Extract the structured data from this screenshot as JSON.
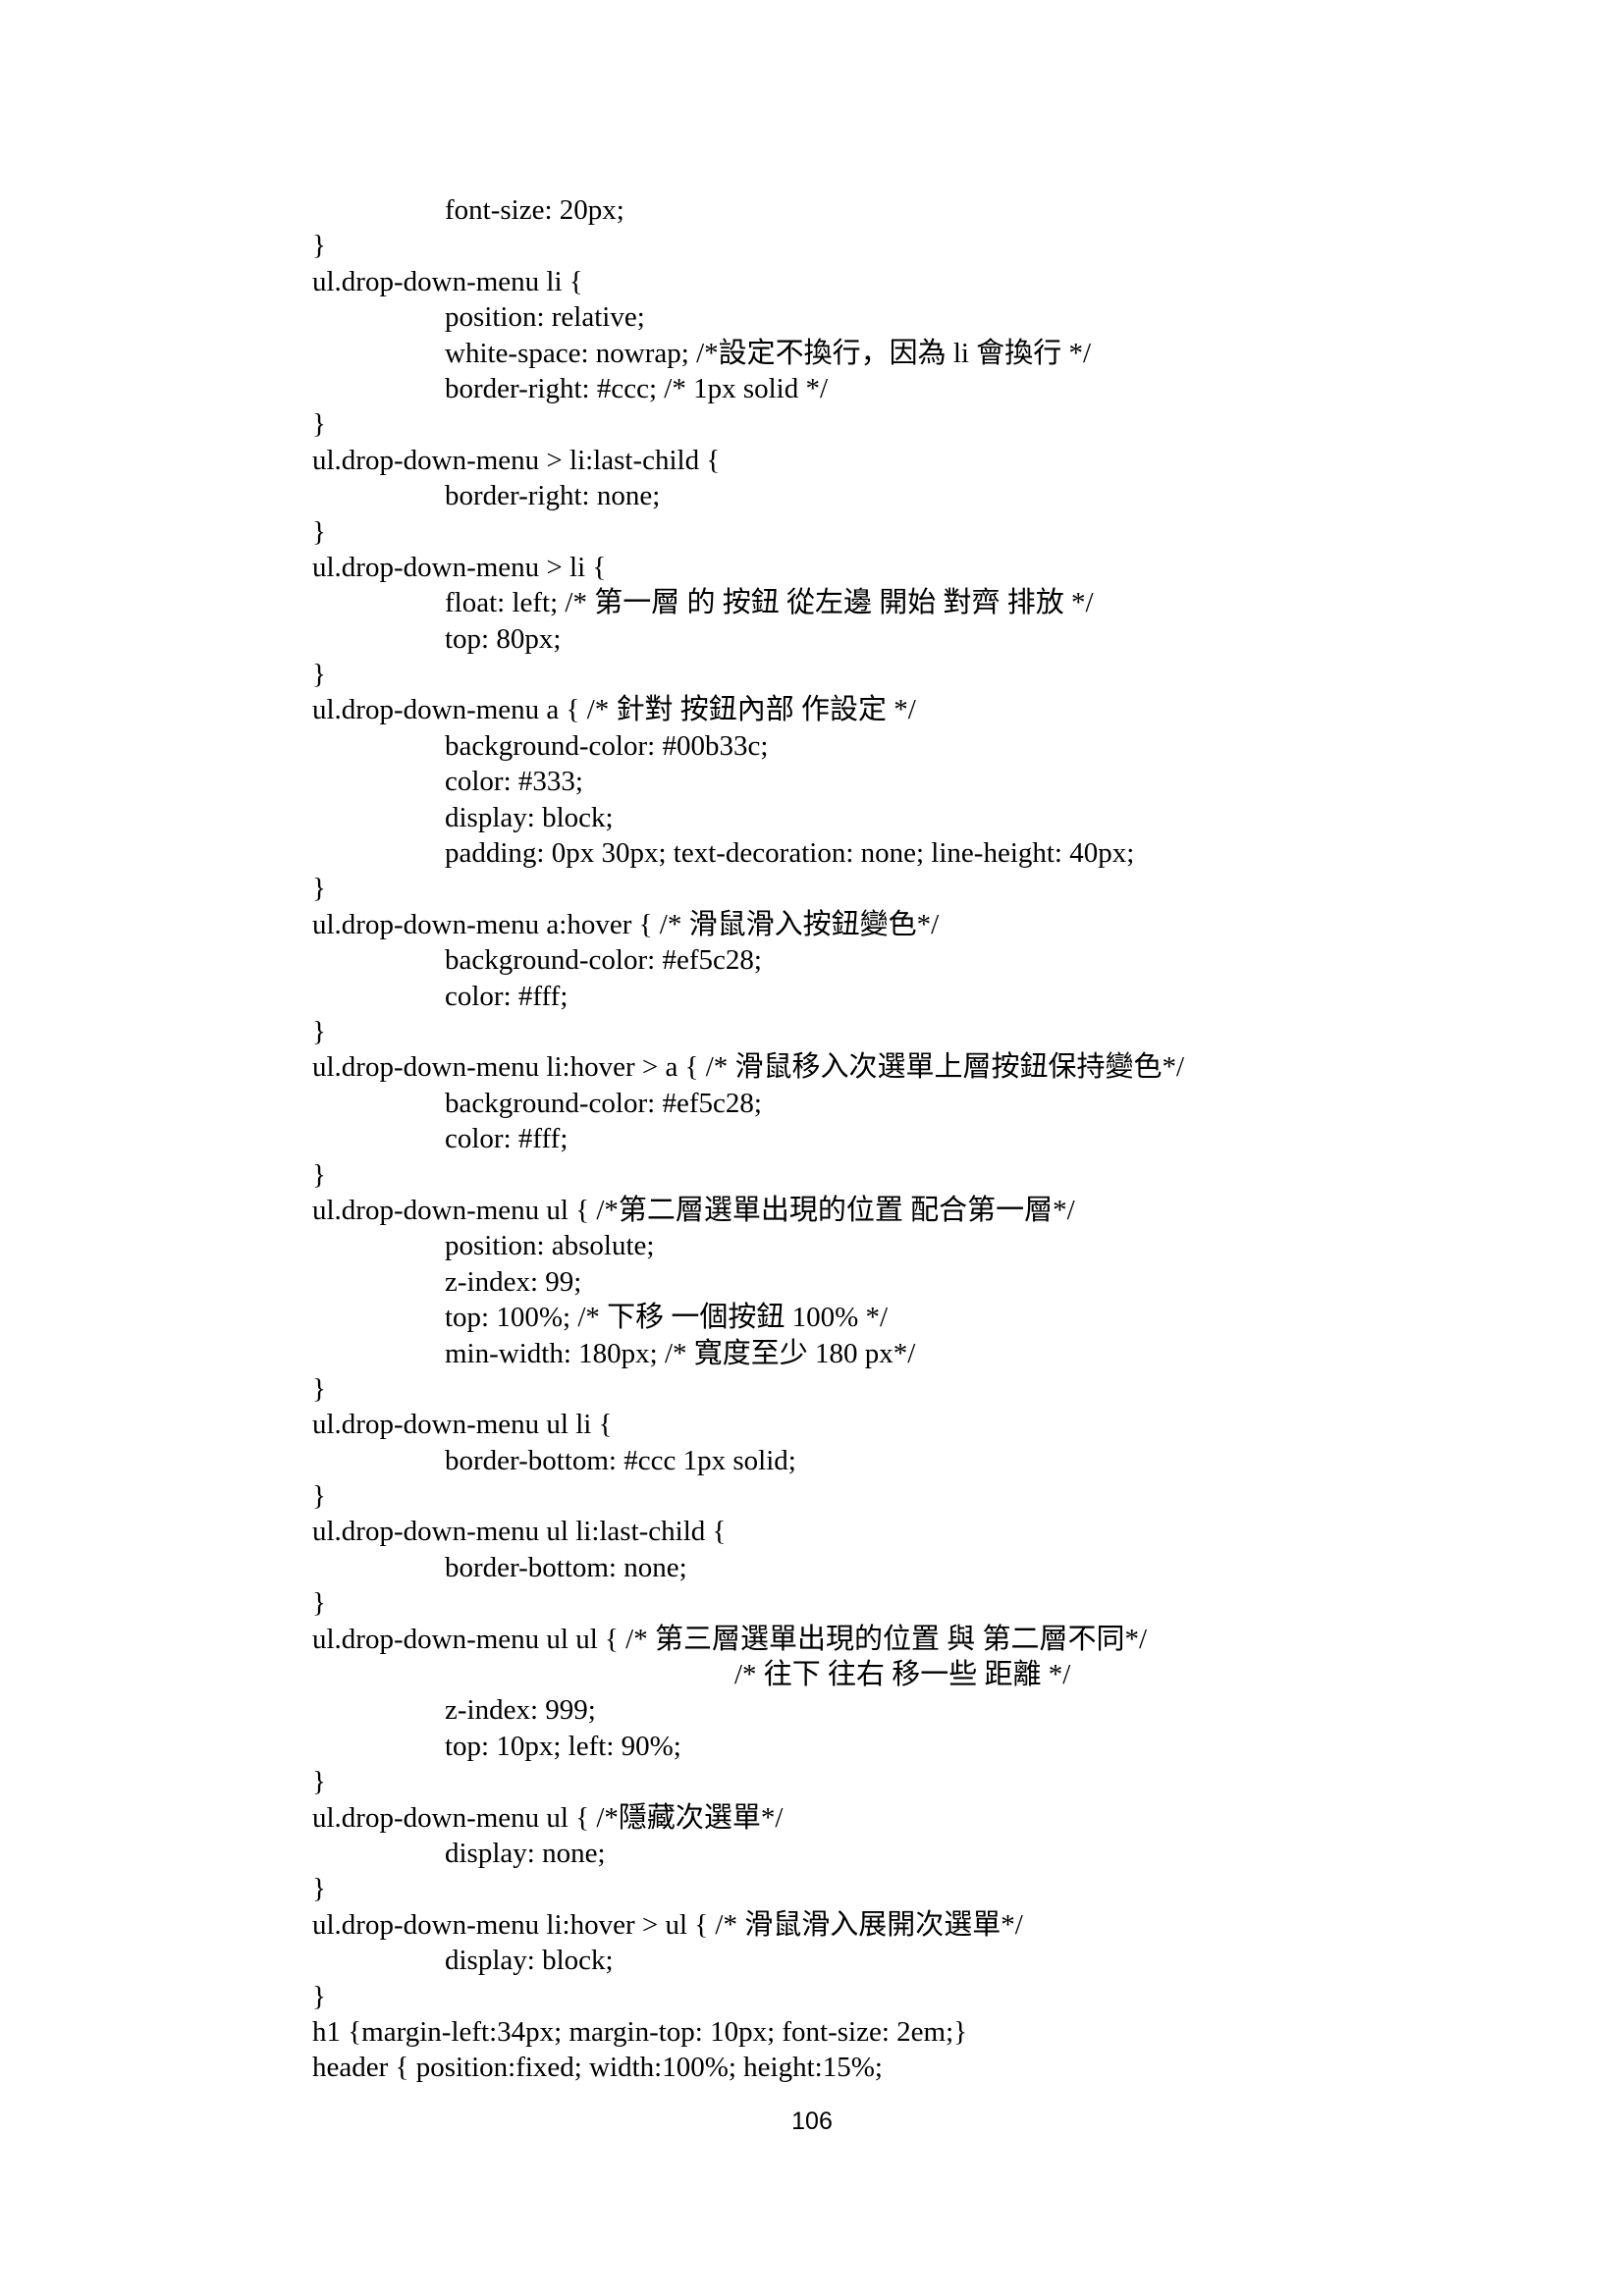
{
  "document": {
    "lines": [
      {
        "indent": 1,
        "text": "font-size: 20px;"
      },
      {
        "indent": 0,
        "text": "}"
      },
      {
        "indent": 0,
        "text": "ul.drop-down-menu li {"
      },
      {
        "indent": 1,
        "text": "position: relative;"
      },
      {
        "indent": 1,
        "text": "white-space: nowrap; /*設定不換行，因為 li 會換行 */"
      },
      {
        "indent": 1,
        "text": "border-right: #ccc; /* 1px solid */"
      },
      {
        "indent": 0,
        "text": "}"
      },
      {
        "indent": 0,
        "text": "ul.drop-down-menu > li:last-child {"
      },
      {
        "indent": 1,
        "text": "border-right: none;"
      },
      {
        "indent": 0,
        "text": "}"
      },
      {
        "indent": 0,
        "text": "ul.drop-down-menu > li {"
      },
      {
        "indent": 1,
        "text": "float: left; /* 第一層 的 按鈕 從左邊 開始 對齊 排放 */"
      },
      {
        "indent": 1,
        "text": "top: 80px;"
      },
      {
        "indent": 0,
        "text": "}"
      },
      {
        "indent": 0,
        "text": "ul.drop-down-menu a { /* 針對 按鈕內部 作設定 */"
      },
      {
        "indent": 1,
        "text": "background-color: #00b33c;"
      },
      {
        "indent": 1,
        "text": "color: #333;"
      },
      {
        "indent": 1,
        "text": "display: block;"
      },
      {
        "indent": 1,
        "text": "padding: 0px 30px; text-decoration: none; line-height: 40px;"
      },
      {
        "indent": 0,
        "text": "}"
      },
      {
        "indent": 0,
        "text": "ul.drop-down-menu a:hover { /* 滑鼠滑入按鈕變色*/"
      },
      {
        "indent": 1,
        "text": "background-color: #ef5c28;"
      },
      {
        "indent": 1,
        "text": "color: #fff;"
      },
      {
        "indent": 0,
        "text": "}"
      },
      {
        "indent": 0,
        "text": "ul.drop-down-menu li:hover > a { /* 滑鼠移入次選單上層按鈕保持變色*/"
      },
      {
        "indent": 1,
        "text": "background-color: #ef5c28;"
      },
      {
        "indent": 1,
        "text": "color: #fff;"
      },
      {
        "indent": 0,
        "text": "}"
      },
      {
        "indent": 0,
        "text": "ul.drop-down-menu ul { /*第二層選單出現的位置 配合第一層*/"
      },
      {
        "indent": 1,
        "text": "position: absolute;"
      },
      {
        "indent": 1,
        "text": "z-index: 99;"
      },
      {
        "indent": 1,
        "text": "top: 100%; /* 下移 一個按鈕 100% */"
      },
      {
        "indent": 1,
        "text": "min-width: 180px; /* 寬度至少 180 px*/"
      },
      {
        "indent": 0,
        "text": "}"
      },
      {
        "indent": 0,
        "text": "ul.drop-down-menu ul li {"
      },
      {
        "indent": 1,
        "text": "border-bottom: #ccc 1px solid;"
      },
      {
        "indent": 0,
        "text": "}"
      },
      {
        "indent": 0,
        "text": "ul.drop-down-menu ul li:last-child {"
      },
      {
        "indent": 1,
        "text": "border-bottom: none;"
      },
      {
        "indent": 0,
        "text": "}"
      },
      {
        "indent": 0,
        "text": "ul.drop-down-menu ul ul { /* 第三層選單出現的位置 與 第二層不同*/"
      },
      {
        "indent": 2,
        "text": "/* 往下 往右 移一些 距離 */"
      },
      {
        "indent": 1,
        "text": "z-index: 999;"
      },
      {
        "indent": 1,
        "text": "top: 10px; left: 90%;"
      },
      {
        "indent": 0,
        "text": "}"
      },
      {
        "indent": 0,
        "text": "ul.drop-down-menu ul { /*隱藏次選單*/"
      },
      {
        "indent": 1,
        "text": "display: none;"
      },
      {
        "indent": 0,
        "text": "}"
      },
      {
        "indent": 0,
        "text": "ul.drop-down-menu li:hover > ul { /* 滑鼠滑入展開次選單*/"
      },
      {
        "indent": 1,
        "text": "display: block;"
      },
      {
        "indent": 0,
        "text": "}"
      },
      {
        "indent": 0,
        "text": "h1 {margin-left:34px; margin-top: 10px; font-size: 2em;}"
      },
      {
        "indent": 0,
        "text": "header { position:fixed; width:100%; height:15%;"
      }
    ],
    "page_number": "106"
  }
}
